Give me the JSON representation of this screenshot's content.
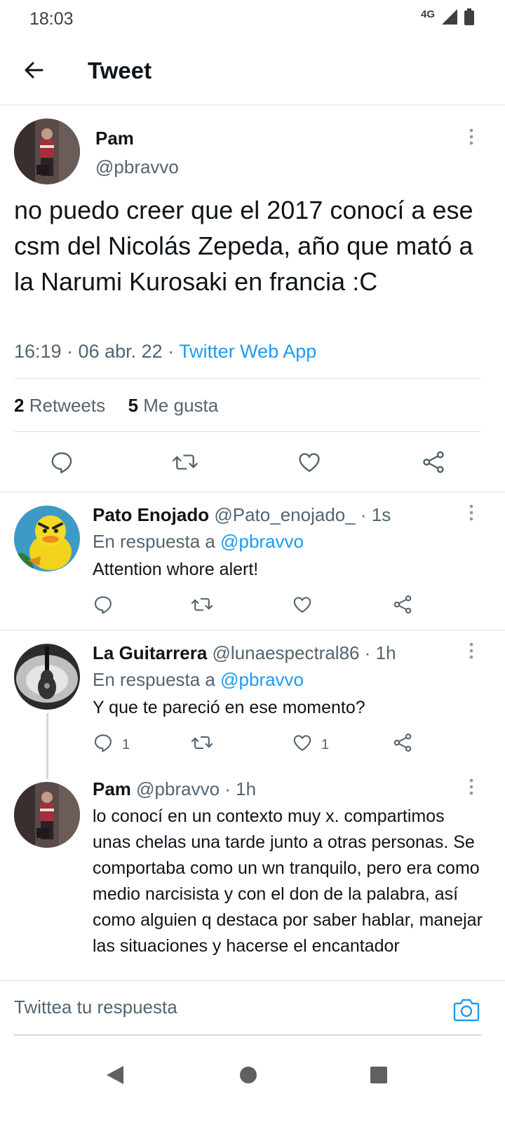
{
  "status_bar": {
    "time": "18:03",
    "network": "4G"
  },
  "app_bar": {
    "title": "Tweet"
  },
  "main_tweet": {
    "name": "Pam",
    "handle": "@pbravvo",
    "text": "no puedo creer que el 2017 conocí a ese csm del Nicolás Zepeda, año que mató a la Narumi Kurosaki en francia :C",
    "time": "16:19 · 06 abr. 22 · ",
    "source": "Twitter Web App",
    "retweets_count": "2",
    "retweets_label": "Retweets",
    "likes_count": "5",
    "likes_label": "Me gusta"
  },
  "replies": [
    {
      "name": "Pato Enojado",
      "handle": "@Pato_enojado_ · 1s",
      "reply_prefix": "En respuesta a ",
      "reply_to": "@pbravvo",
      "text": "Attention whore alert!",
      "reply_count": "",
      "like_count": ""
    },
    {
      "name": "La Guitarrera",
      "handle": "@lunaespectral86 · 1h",
      "reply_prefix": "En respuesta a ",
      "reply_to": "@pbravvo",
      "text": "Y que te pareció en ese momento?",
      "reply_count": "1",
      "like_count": "1"
    },
    {
      "name": "Pam",
      "handle": "@pbravvo · 1h",
      "text": "lo conocí en un contexto muy x. compartimos unas chelas una tarde junto a otras personas. Se comportaba como un wn tranquilo, pero era como medio narcisista y con el don de la palabra, así como alguien q destaca por saber hablar, manejar las situaciones y hacerse el encantador"
    }
  ],
  "compose": {
    "placeholder": "Twittea tu respuesta"
  },
  "colors": {
    "accent": "#1d9bf0",
    "secondary_text": "#536471",
    "divider": "#dfe3e6"
  }
}
